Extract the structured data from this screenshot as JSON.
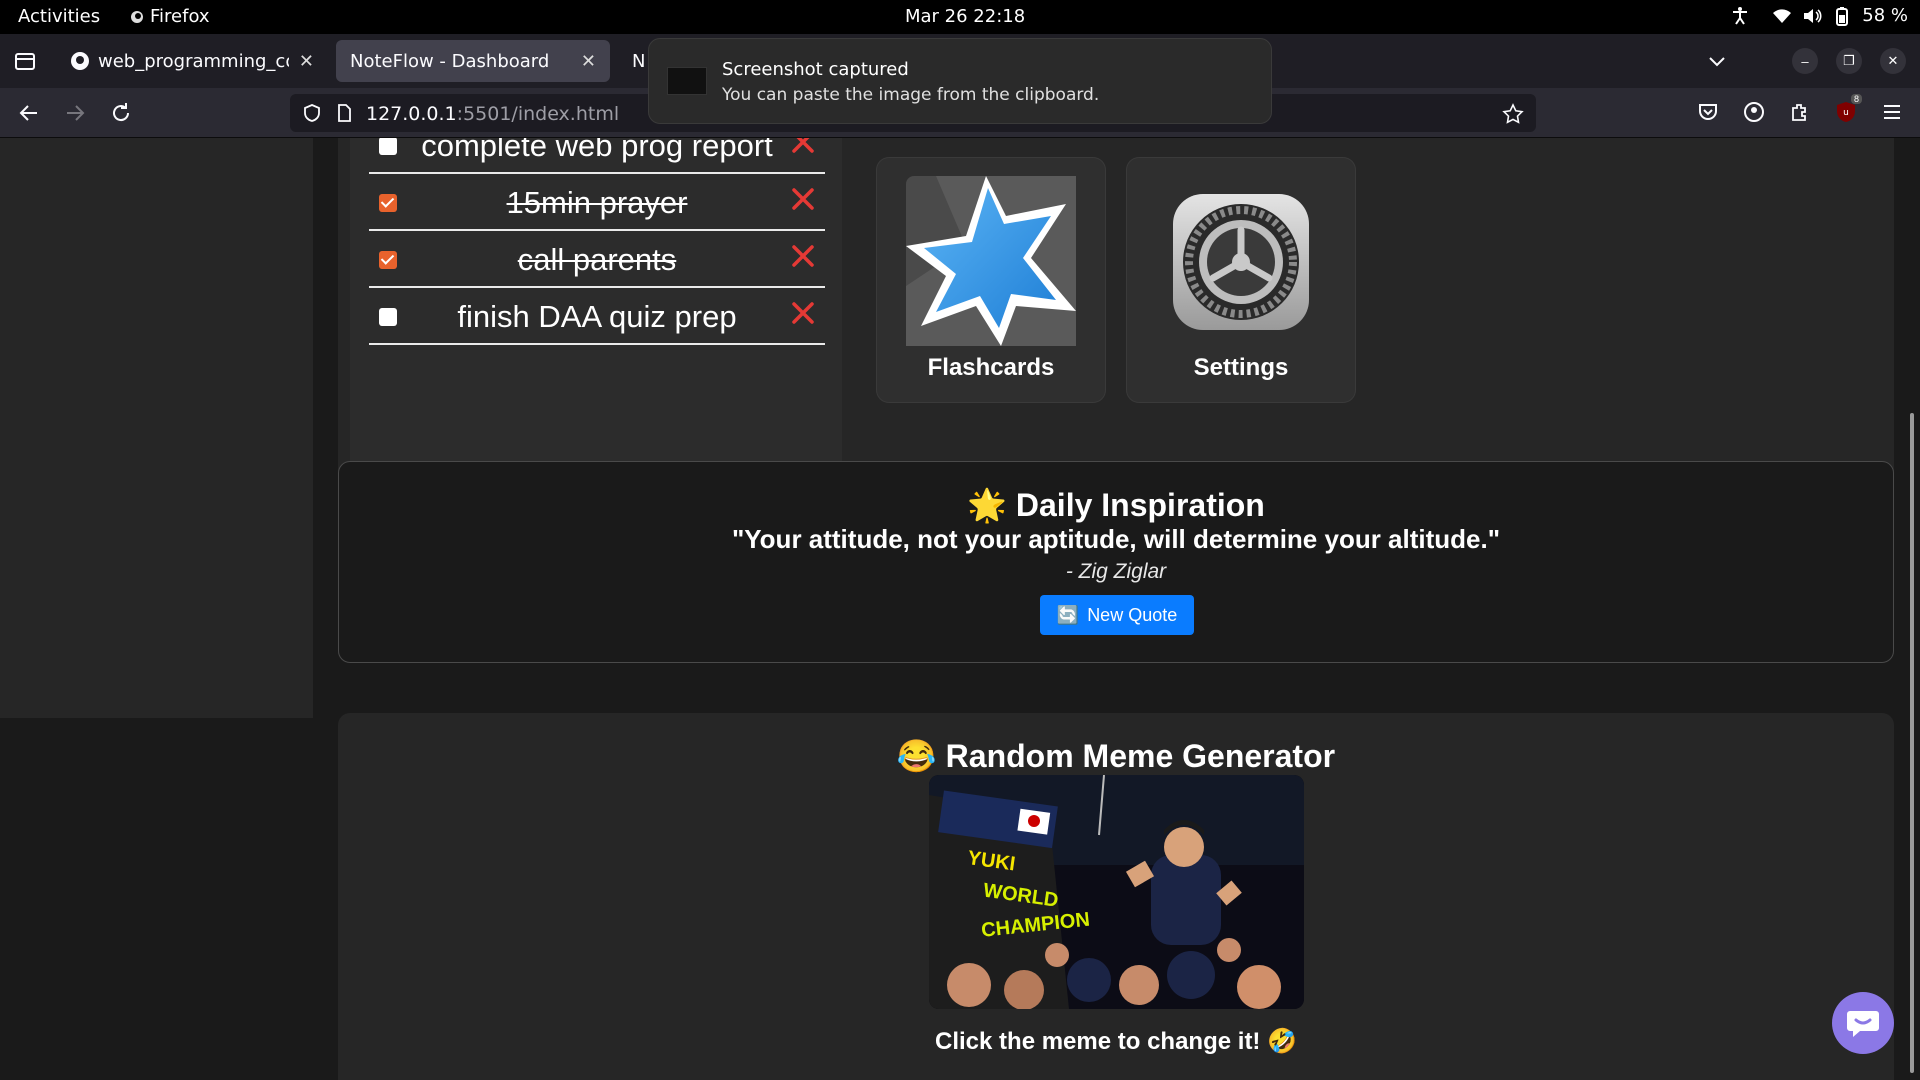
{
  "os": {
    "activities": "Activities",
    "app_name": "Firefox",
    "clock": "Mar 26  22:18",
    "battery": "58 %"
  },
  "browser": {
    "tabs": [
      {
        "title": "web_programming_code"
      },
      {
        "title": "NoteFlow - Dashboard"
      },
      {
        "title": "N"
      }
    ],
    "url_main": "127.0.0.1",
    "url_rest": ":5501/index.html",
    "extension_badge": "8"
  },
  "notification": {
    "title": "Screenshot captured",
    "body": "You can paste the image from the clipboard."
  },
  "todos": [
    {
      "text": "complete web prog report",
      "done": false
    },
    {
      "text": "15min prayer",
      "done": true
    },
    {
      "text": "call parents",
      "done": true
    },
    {
      "text": "finish DAA quiz prep",
      "done": false
    }
  ],
  "apps": {
    "flashcards": "Flashcards",
    "settings": "Settings"
  },
  "inspiration": {
    "emoji": "🌟",
    "heading": "Daily Inspiration",
    "quote": "\"Your attitude, not your aptitude, will determine your altitude.\"",
    "author": "- Zig Ziglar",
    "button_icon": "🔄",
    "button_label": "New Quote"
  },
  "meme": {
    "emoji": "😂",
    "heading": "Random Meme Generator",
    "image_text_1": "YUKI",
    "image_text_2": "WORLD",
    "image_text_3": "CHAMPION",
    "caption": "Click the meme to change it! 🤣"
  },
  "colors": {
    "accent_blue": "#0a7cff",
    "checkbox_orange": "#e8622c",
    "delete_red": "#e53935",
    "chat_purple": "#8b78e6"
  }
}
